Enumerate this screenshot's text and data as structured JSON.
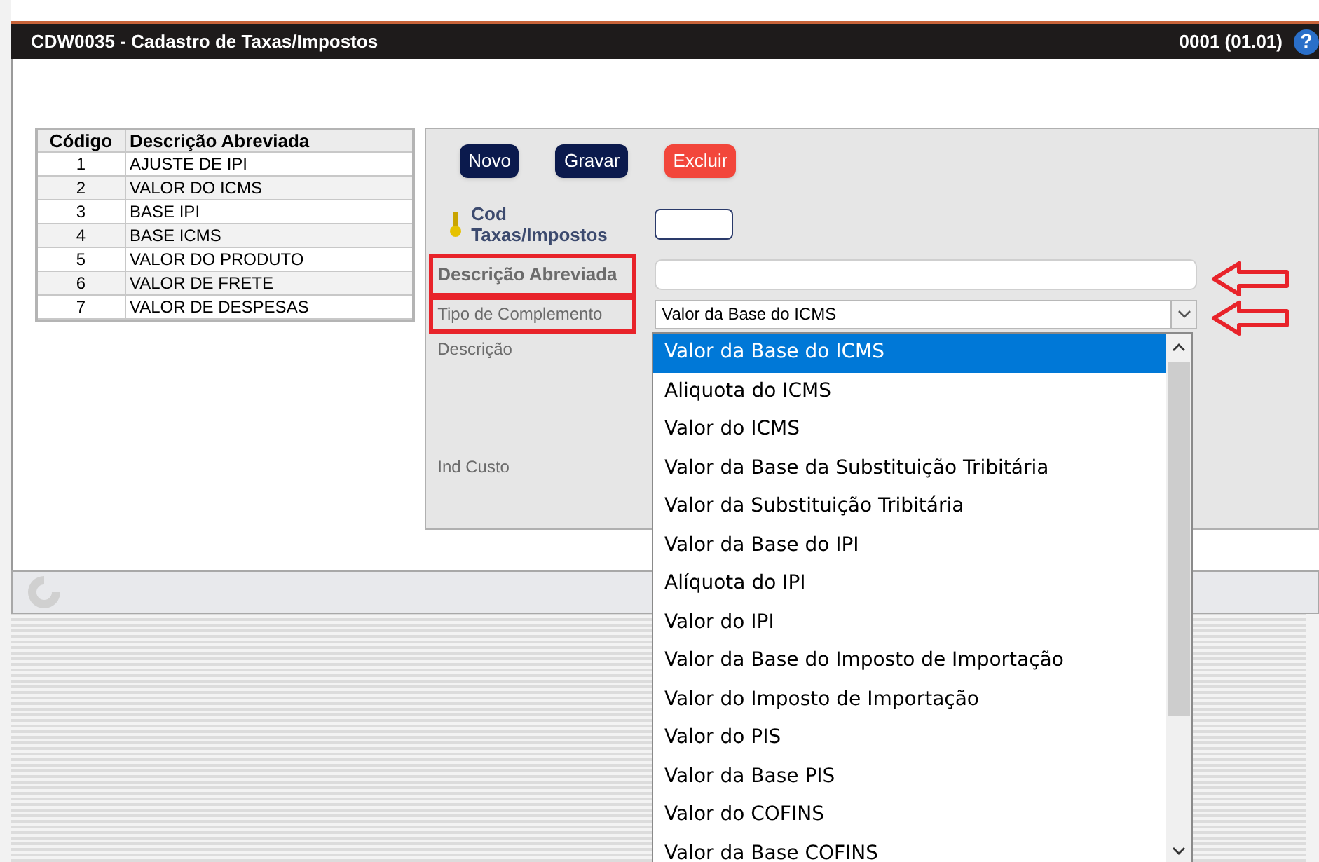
{
  "window": {
    "title": "CDW0035 - Cadastro de Taxas/Impostos",
    "version": "0001 (01.01)",
    "help": "?"
  },
  "table": {
    "columns": [
      "Código",
      "Descrição Abreviada"
    ],
    "rows": [
      [
        "1",
        "AJUSTE DE IPI"
      ],
      [
        "2",
        "VALOR DO ICMS"
      ],
      [
        "3",
        "BASE IPI"
      ],
      [
        "4",
        "BASE ICMS"
      ],
      [
        "5",
        "VALOR DO PRODUTO"
      ],
      [
        "6",
        "VALOR DE FRETE"
      ],
      [
        "7",
        "VALOR DE DESPESAS"
      ]
    ]
  },
  "buttons": [
    {
      "label": "Novo",
      "kind": "primary"
    },
    {
      "label": "Gravar",
      "kind": "primary"
    },
    {
      "label": "Excluir",
      "kind": "danger"
    }
  ],
  "fields": [
    {
      "label": "Cod Taxas/Impostos",
      "kind": "key",
      "highlighted": false
    },
    {
      "label": "Descrição Abreviada",
      "kind": "text",
      "highlighted": true
    },
    {
      "label": "Tipo de Complemento",
      "kind": "select",
      "value": "Valor da Base do ICMS",
      "expanded": true,
      "highlighted": true
    },
    {
      "label": "Descrição",
      "kind": "label",
      "highlighted": false
    },
    {
      "label": "Ind Custo",
      "kind": "label",
      "highlighted": false
    }
  ],
  "dropdown": {
    "options": [
      {
        "label": "Valor da Base do ICMS",
        "selected": true
      },
      {
        "label": "Aliquota do ICMS",
        "selected": false
      },
      {
        "label": "Valor do ICMS",
        "selected": false
      },
      {
        "label": "Valor da Base da Substituição Tribitária",
        "selected": false
      },
      {
        "label": "Valor da Substituição Tribitária",
        "selected": false
      },
      {
        "label": "Valor da Base do IPI",
        "selected": false
      },
      {
        "label": "Alíquota do IPI",
        "selected": false
      },
      {
        "label": "Valor do IPI",
        "selected": false
      },
      {
        "label": "Valor da Base do Imposto de Importação",
        "selected": false
      },
      {
        "label": "Valor do Imposto de Importação",
        "selected": false
      },
      {
        "label": "Valor do PIS",
        "selected": false
      },
      {
        "label": "Valor da Base PIS",
        "selected": false
      },
      {
        "label": "Valor do COFINS",
        "selected": false
      },
      {
        "label": "Valor da Base COFINS",
        "selected": false
      }
    ]
  }
}
